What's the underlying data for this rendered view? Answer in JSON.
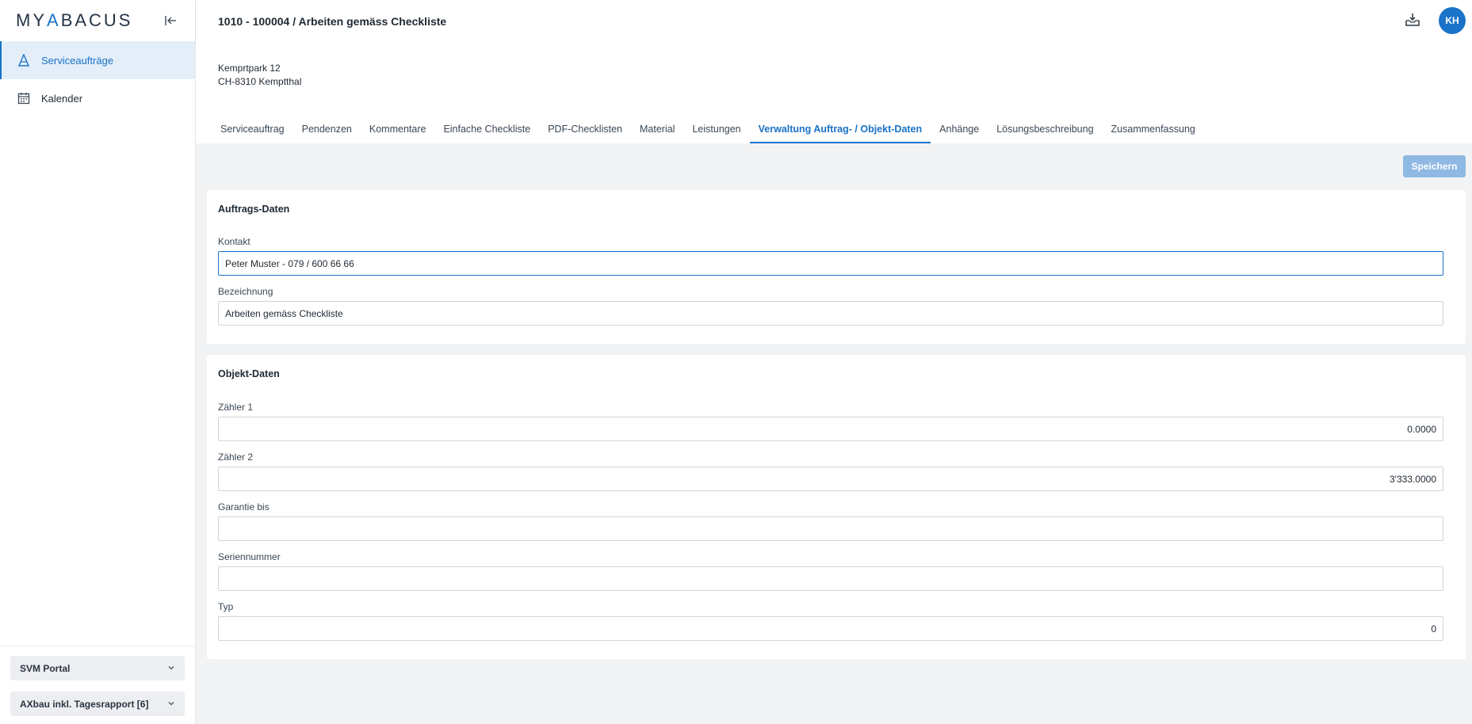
{
  "app": {
    "logo_left": "MY",
    "logo_mid": "A",
    "logo_right": "BACUS"
  },
  "sidebar": {
    "items": [
      {
        "label": "Serviceaufträge",
        "icon": "cone-icon",
        "active": true
      },
      {
        "label": "Kalender",
        "icon": "calendar-icon",
        "active": false
      }
    ],
    "bottom": [
      {
        "label": "SVM Portal"
      },
      {
        "label": "AXbau inkl. Tagesrapport [6]"
      }
    ]
  },
  "header": {
    "title": "1010 - 100004 / Arbeiten gemäss Checkliste",
    "avatar_initials": "KH"
  },
  "address": {
    "street": "Kemprtpark 12",
    "city": "CH-8310 Kemptthal"
  },
  "tabs": [
    {
      "label": "Serviceauftrag"
    },
    {
      "label": "Pendenzen"
    },
    {
      "label": "Kommentare"
    },
    {
      "label": "Einfache Checkliste"
    },
    {
      "label": "PDF-Checklisten"
    },
    {
      "label": "Material"
    },
    {
      "label": "Leistungen"
    },
    {
      "label": "Verwaltung Auftrag- / Objekt-Daten",
      "active": true
    },
    {
      "label": "Anhänge"
    },
    {
      "label": "Lösungsbeschreibung"
    },
    {
      "label": "Zusammenfassung"
    }
  ],
  "actions": {
    "save_label": "Speichern"
  },
  "auftrag": {
    "title": "Auftrags-Daten",
    "kontakt_label": "Kontakt",
    "kontakt_value": "Peter Muster - 079 / 600 66 66",
    "bezeichnung_label": "Bezeichnung",
    "bezeichnung_value": "Arbeiten gemäss Checkliste"
  },
  "objekt": {
    "title": "Objekt-Daten",
    "zaehler1_label": "Zähler 1",
    "zaehler1_value": "0.0000",
    "zaehler2_label": "Zähler 2",
    "zaehler2_value": "3'333.0000",
    "garantie_label": "Garantie bis",
    "garantie_value": "",
    "serien_label": "Seriennummer",
    "serien_value": "",
    "typ_label": "Typ",
    "typ_value": "0"
  },
  "colors": {
    "accent": "#1a73c8",
    "save_disabled": "#8fb9e3",
    "background": "#f2f3f5"
  }
}
